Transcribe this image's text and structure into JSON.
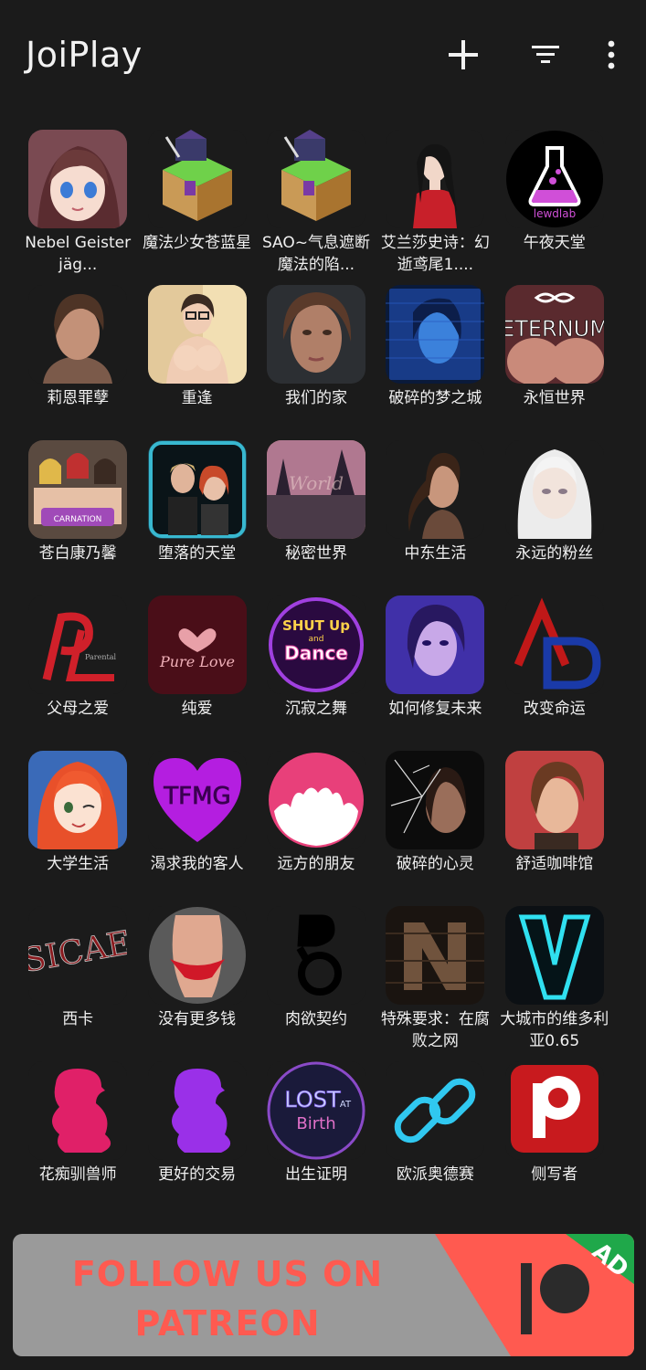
{
  "app": {
    "title": "JoiPlay"
  },
  "toolbar": {
    "add_icon": "plus-icon",
    "filter_icon": "filter-icon",
    "more_icon": "more-vert-icon"
  },
  "games": [
    {
      "label": "Nebel Geisterjäg...",
      "art": "anime-girl"
    },
    {
      "label": "魔法少女苍蓝星",
      "art": "rpgmaker-cube"
    },
    {
      "label": "SAO~气息遮断魔法的陷...",
      "art": "rpgmaker-cube"
    },
    {
      "label": "艾兰莎史诗：幻逝鸢尾1....",
      "art": "warrior-woman"
    },
    {
      "label": "午夜天堂",
      "art": "lewdlab-flask"
    },
    {
      "label": "莉恩罪孽",
      "art": "boy-portrait"
    },
    {
      "label": "重逢",
      "art": "woman-glasses"
    },
    {
      "label": "我们的家",
      "art": "woman-face"
    },
    {
      "label": "破碎的梦之城",
      "art": "blue-screen"
    },
    {
      "label": "永恒世界",
      "art": "eternum"
    },
    {
      "label": "苍白康乃馨",
      "art": "group-girls"
    },
    {
      "label": "堕落的天堂",
      "art": "couple"
    },
    {
      "label": "秘密世界",
      "art": "sunset-world"
    },
    {
      "label": "中东生活",
      "art": "ponytail-woman"
    },
    {
      "label": "永远的粉丝",
      "art": "white-hair"
    },
    {
      "label": "父母之爱",
      "art": "pl-logo"
    },
    {
      "label": "纯爱",
      "art": "pure-love"
    },
    {
      "label": "沉寂之舞",
      "art": "shut-up-dance"
    },
    {
      "label": "如何修复未来",
      "art": "blue-portrait"
    },
    {
      "label": "改变命运",
      "art": "ad-logo"
    },
    {
      "label": "大学生活",
      "art": "red-hair-anime"
    },
    {
      "label": "渴求我的客人",
      "art": "tfmg-heart"
    },
    {
      "label": "远方的朋友",
      "art": "pink-circle"
    },
    {
      "label": "破碎的心灵",
      "art": "shattered-glass"
    },
    {
      "label": "舒适咖啡馆",
      "art": "cafe-girl"
    },
    {
      "label": "西卡",
      "art": "sicae-logo"
    },
    {
      "label": "没有更多钱",
      "art": "red-lingerie"
    },
    {
      "label": "肉欲契约",
      "art": "contract-logo"
    },
    {
      "label": "特殊要求：在腐败之网",
      "art": "n-logo"
    },
    {
      "label": "大城市的维多利亚0.65",
      "art": "v-neon"
    },
    {
      "label": "花痴驯兽师",
      "art": "pink-silhouette"
    },
    {
      "label": "更好的交易",
      "art": "purple-silhouette"
    },
    {
      "label": "出生证明",
      "art": "lost-at-birth"
    },
    {
      "label": "欧派奥德赛",
      "art": "chain-link"
    },
    {
      "label": "侧写者",
      "art": "profiler-p"
    }
  ],
  "banner": {
    "line1": "FOLLOW US ON",
    "line2": "PATREON",
    "badge": "AD",
    "logo": "patreon-logo"
  },
  "colors": {
    "background": "#1b1b1b",
    "banner_bg": "#9a9a9a",
    "banner_text": "#ff5a50",
    "banner_accent": "#ff5a50",
    "ad_badge": "#1fa84a"
  }
}
